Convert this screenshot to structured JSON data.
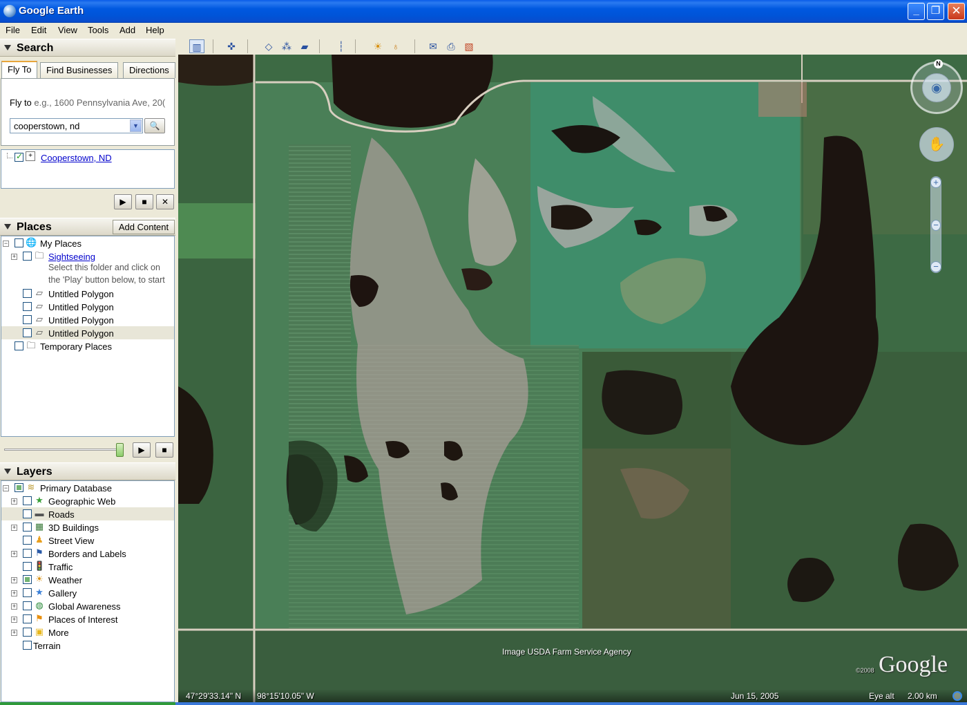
{
  "window": {
    "title": "Google Earth"
  },
  "menu": [
    "File",
    "Edit",
    "View",
    "Tools",
    "Add",
    "Help"
  ],
  "search": {
    "header": "Search",
    "tabs": [
      "Fly To",
      "Find Businesses",
      "Directions"
    ],
    "fly_to_label": "Fly to",
    "fly_to_hint": "e.g., 1600 Pennsylvania Ave, 20(",
    "query": "cooperstown, nd",
    "result": "Cooperstown, ND"
  },
  "places": {
    "header": "Places",
    "add_content": "Add Content",
    "my_places": "My Places",
    "sightseeing": "Sightseeing",
    "sightseeing_desc_1": "Select this folder and click on",
    "sightseeing_desc_2": "the 'Play' button below, to start",
    "polygons": [
      "Untitled Polygon",
      "Untitled Polygon",
      "Untitled Polygon",
      "Untitled Polygon"
    ],
    "temporary": "Temporary Places"
  },
  "layers": {
    "header": "Layers",
    "items": [
      {
        "label": "Primary Database",
        "icon": "database-icon"
      },
      {
        "label": "Geographic Web",
        "icon": "star-icon"
      },
      {
        "label": "Roads",
        "icon": "road-icon"
      },
      {
        "label": "3D Buildings",
        "icon": "building-icon"
      },
      {
        "label": "Street View",
        "icon": "person-icon"
      },
      {
        "label": "Borders and Labels",
        "icon": "flag-icon"
      },
      {
        "label": "Traffic",
        "icon": "traffic-icon"
      },
      {
        "label": "Weather",
        "icon": "sun-icon"
      },
      {
        "label": "Gallery",
        "icon": "star-icon"
      },
      {
        "label": "Global Awareness",
        "icon": "globe-icon"
      },
      {
        "label": "Places of Interest",
        "icon": "flag-icon"
      },
      {
        "label": "More",
        "icon": "folder-icon"
      },
      {
        "label": "Terrain",
        "icon": "none"
      }
    ]
  },
  "map": {
    "credit": "Image USDA Farm Service Agency",
    "latitude": "47°29'33.14\" N",
    "longitude": "98°15'10.05\" W",
    "date": "Jun 15, 2005",
    "eye_alt_label": "Eye alt",
    "eye_alt_value": "2.00 km",
    "logo": "Google",
    "logo_year": "©2008",
    "compass_letter": "N"
  },
  "colors": {
    "title_bar": "#0054d8",
    "link": "#0000cc",
    "panel_bg": "#ece9d8"
  }
}
